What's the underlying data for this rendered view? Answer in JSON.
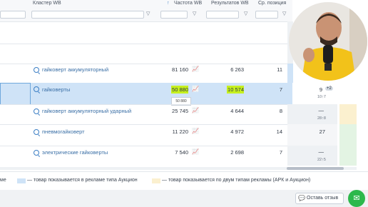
{
  "header": {
    "cluster_label": "Кластер WB",
    "freq_label": "Частота WB",
    "results_label": "Результатов WB",
    "avg_pos_label": "Ср. позиция",
    "sort_arrow": "↑"
  },
  "rows": [
    {
      "keyword": "гайковерт аккумуляторный",
      "freq": "81 160",
      "results": "6 263",
      "avg_pos": "11",
      "cell": "",
      "sub": ""
    },
    {
      "keyword": "гайковерты",
      "freq": "50 880",
      "results": "10 574",
      "avg_pos": "7",
      "cell": "9",
      "badge": "+2",
      "sub": "10↑7"
    },
    {
      "keyword": "гайковерт аккумуляторный ударный",
      "freq": "25 745",
      "results": "4 644",
      "avg_pos": "8",
      "cell": "—",
      "sub": "28↑8"
    },
    {
      "keyword": "пневмогайковерт",
      "freq": "11 220",
      "results": "4 972",
      "avg_pos": "14",
      "cell": "27",
      "sub": ""
    },
    {
      "keyword": "электрические гайковерты",
      "freq": "7 540",
      "results": "2 698",
      "avg_pos": "7",
      "cell": "—",
      "sub": "22↑5"
    }
  ],
  "tooltip": "50 880",
  "legend": {
    "left_fragment": "ме",
    "auction": "— товар показывается в рекламе типа Аукцион",
    "both": "— товар показывается по двум типам рекламы (АРК и Аукцион)"
  },
  "feedback_button": "Оставь отзыв",
  "icons": [
    "search-icon",
    "chart-icon",
    "filter-icon",
    "chat-icon"
  ],
  "colors": {
    "highlight_row": "#cfe3f7",
    "lime_highlight": "#c6f01e",
    "auction_blue": "#cfe3f7",
    "both_yellow": "#fbf0cf",
    "green_cell": "#e3f4e3",
    "chat_green": "#2db84c"
  }
}
